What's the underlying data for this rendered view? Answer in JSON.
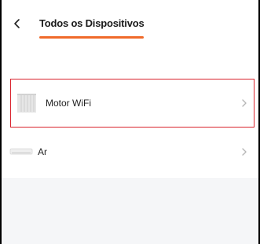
{
  "header": {
    "title": "Todos os Dispositivos",
    "back_icon": "chevron-left-icon",
    "accent_color": "#f06a2a"
  },
  "devices": [
    {
      "label": "Motor WiFi",
      "icon": "curtain-motor-icon",
      "selected": true
    },
    {
      "label": "Ar",
      "icon": "air-conditioner-icon",
      "selected": false
    }
  ],
  "highlight_color": "#d9232d"
}
